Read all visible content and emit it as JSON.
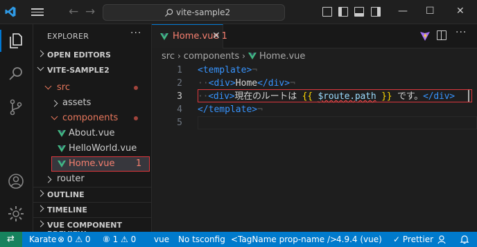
{
  "titlebar": {
    "search_text": "vite-sample2",
    "back_icon": "←",
    "forward_icon": "→",
    "minimize_icon": "—",
    "maximize_icon": "☐",
    "close_icon": "✕"
  },
  "sidebar": {
    "title": "EXPLORER",
    "more": "···",
    "sections": {
      "open_editors": "OPEN EDITORS",
      "project": "VITE-SAMPLE2",
      "outline": "OUTLINE",
      "timeline": "TIMELINE",
      "vue_preview": "VUE COMPONENT PREVIEW"
    },
    "tree": {
      "src": "src",
      "assets": "assets",
      "components": "components",
      "about": "About.vue",
      "helloworld": "HelloWorld.vue",
      "home": "Home.vue",
      "home_errors": "1",
      "router": "router"
    }
  },
  "editor": {
    "tab_label": "Home.vue 1",
    "tab_close": "✕",
    "breadcrumb": [
      "src",
      "components",
      "Home.vue"
    ],
    "line_numbers": [
      "1",
      "2",
      "3",
      "4",
      "5"
    ],
    "code": {
      "l1_open": "<template>",
      "l2_open": "<div>",
      "l2_text": "Home",
      "l2_close": "</div>",
      "l3_open": "<div>",
      "l3_text": "現在のルートは ",
      "l3_brace_open": "{{",
      "l3_expr": "$route.path",
      "l3_brace_close": "}}",
      "l3_text2": " です。",
      "l3_close": "</div>",
      "l4_close": "</template>",
      "ws_dot": "··",
      "eol": "¬"
    }
  },
  "statusbar": {
    "remote_icon": "⇄",
    "karate": "Karate",
    "problems": "⊗ 0 ⚠ 0",
    "info": "⑧ 1 ⚠ 0",
    "language": "vue",
    "tsconfig": "No tsconfig",
    "tag_format": "<TagName prop-name />",
    "version": "4.9.4 (vue)",
    "prettier": "✓ Prettier",
    "bell_icon": "🔔"
  }
}
